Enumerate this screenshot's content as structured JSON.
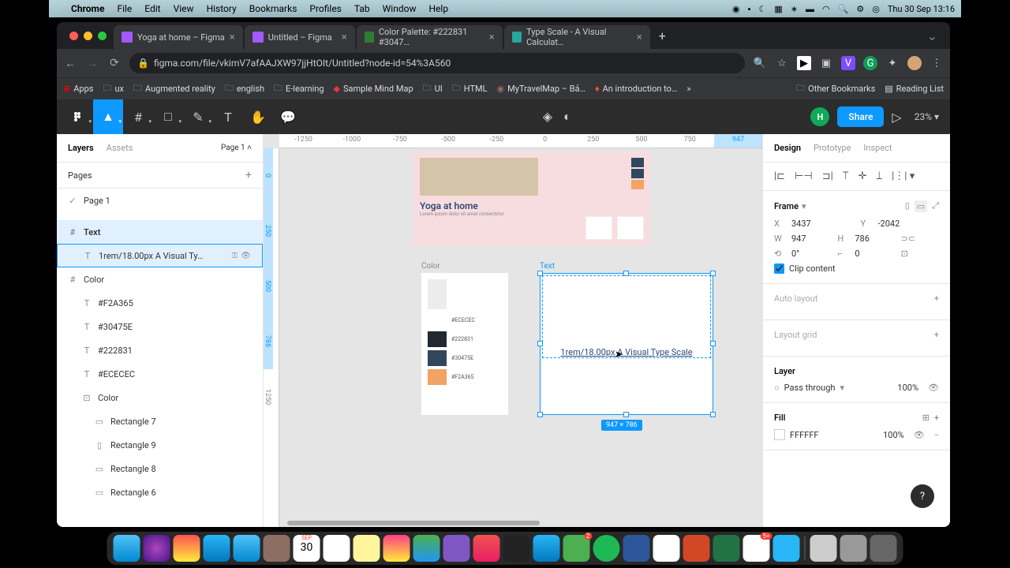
{
  "menubar": {
    "app": "Chrome",
    "items": [
      "File",
      "Edit",
      "View",
      "History",
      "Bookmarks",
      "Profiles",
      "Tab",
      "Window",
      "Help"
    ],
    "clock": "Thu 30 Sep  13:16"
  },
  "tabs": [
    {
      "title": "Yoga at home – Figma",
      "fav": "#a259ff"
    },
    {
      "title": "Untitled – Figma",
      "fav": "#a259ff"
    },
    {
      "title": "Color Palette: #222831 #3047…",
      "fav": "#2e7d32"
    },
    {
      "title": "Type Scale - A Visual Calculat…",
      "fav": "#26a69a"
    }
  ],
  "url": "figma.com/file/vkimV7afAAJXW97jjHtOIt/Untitled?node-id=54%3A560",
  "bookmarks": {
    "items": [
      "Apps",
      "ux",
      "Augmented reality",
      "english",
      "E-learning",
      "Sample Mind Map",
      "UI",
      "HTML",
      "MyTravelMap – Bả…",
      "An introduction to…"
    ],
    "more": "»",
    "other": "Other Bookmarks",
    "reading": "Reading List"
  },
  "toolbar": {
    "share": "Share",
    "zoom": "23%"
  },
  "leftpanel": {
    "tab_layers": "Layers",
    "tab_assets": "Assets",
    "page": "Page 1",
    "pages_label": "Pages",
    "page1": "Page 1",
    "frame_text": "Text",
    "text_layer": "1rem/18.00px A Visual Ty…",
    "frame_color": "Color",
    "colors": [
      "#F2A365",
      "#30475E",
      "#222831",
      "#ECECEC"
    ],
    "color_group": "Color",
    "rects": [
      "Rectangle 7",
      "Rectangle 9",
      "Rectangle 8",
      "Rectangle 6"
    ]
  },
  "canvas": {
    "ruler_top": [
      "-1250",
      "-1000",
      "-750",
      "-500",
      "-250",
      "0",
      "250",
      "500",
      "750",
      "947"
    ],
    "ruler_left": [
      "0",
      "250",
      "500",
      "786",
      "1250"
    ],
    "yoga_title": "Yoga at home",
    "color_label": "Color",
    "text_label": "Text",
    "swatches": [
      {
        "c": "#ECECEC",
        "t": "#ECECEC"
      },
      {
        "c": "#222831",
        "t": "#222831"
      },
      {
        "c": "#30475E",
        "t": "#30475E"
      },
      {
        "c": "#F2A365",
        "t": "#F2A365"
      }
    ],
    "text_content": "1rem/18.00px A Visual Type Scale",
    "dim": "947 × 786"
  },
  "rightpanel": {
    "tab_design": "Design",
    "tab_proto": "Prototype",
    "tab_inspect": "Inspect",
    "frame_head": "Frame",
    "x": "3437",
    "y": "-2042",
    "w": "947",
    "h": "786",
    "rot": "0°",
    "rad": "0",
    "clip": "Clip content",
    "auto_layout": "Auto layout",
    "layout_grid": "Layout grid",
    "layer_head": "Layer",
    "blend": "Pass through",
    "opacity": "100%",
    "fill_head": "Fill",
    "fill_color": "FFFFFF",
    "fill_opacity": "100%"
  }
}
